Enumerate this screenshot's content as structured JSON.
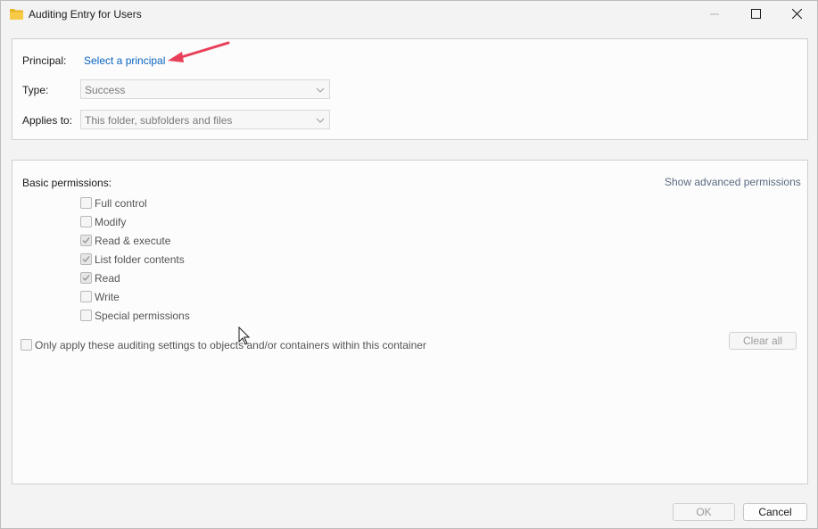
{
  "window": {
    "title": "Auditing Entry for Users",
    "icon": "folder-icon",
    "controls": [
      "minimize-icon",
      "maximize-icon",
      "close-icon"
    ]
  },
  "principal": {
    "label": "Principal:",
    "link_text": "Select a principal"
  },
  "type": {
    "label": "Type:",
    "value": "Success"
  },
  "applies_to": {
    "label": "Applies to:",
    "value": "This folder, subfolders and files"
  },
  "permissions": {
    "heading": "Basic permissions:",
    "advanced_link": "Show advanced permissions",
    "items": [
      {
        "label": "Full control",
        "checked": false
      },
      {
        "label": "Modify",
        "checked": false
      },
      {
        "label": "Read & execute",
        "checked": true
      },
      {
        "label": "List folder contents",
        "checked": true
      },
      {
        "label": "Read",
        "checked": true
      },
      {
        "label": "Write",
        "checked": false
      },
      {
        "label": "Special permissions",
        "checked": false
      }
    ],
    "only_apply_label": "Only apply these auditing settings to objects and/or containers within this container",
    "clear_all_label": "Clear all"
  },
  "footer": {
    "ok_label": "OK",
    "cancel_label": "Cancel"
  },
  "colors": {
    "link": "#0a64c2",
    "annotation_arrow": "#e8405a"
  }
}
